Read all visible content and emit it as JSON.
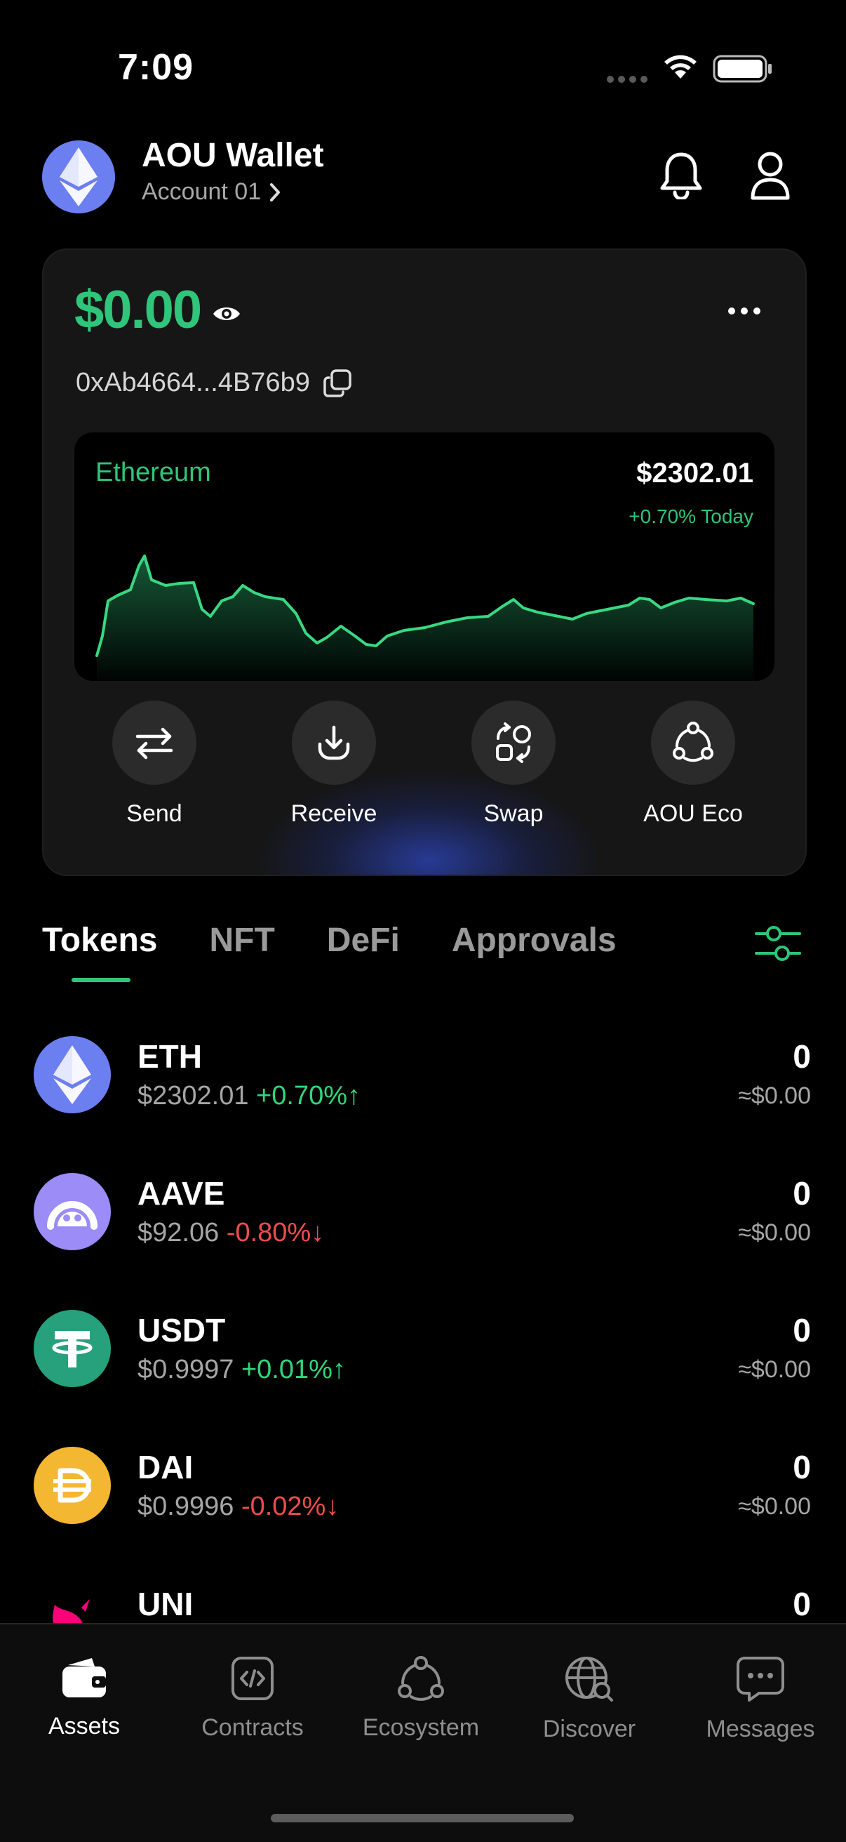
{
  "status_bar": {
    "time": "7:09"
  },
  "header": {
    "wallet_name": "AOU Wallet",
    "account": "Account 01"
  },
  "card": {
    "balance": "$0.00",
    "address": "0xAb4664...4B76b9",
    "chart": {
      "asset": "Ethereum",
      "price": "$2302.01",
      "change": "+0.70% Today"
    },
    "actions": [
      {
        "label": "Send",
        "icon": "send-icon"
      },
      {
        "label": "Receive",
        "icon": "receive-icon"
      },
      {
        "label": "Swap",
        "icon": "swap-icon"
      },
      {
        "label": "AOU Eco",
        "icon": "eco-icon"
      }
    ]
  },
  "tabs": [
    "Tokens",
    "NFT",
    "DeFi",
    "Approvals"
  ],
  "tokens": [
    {
      "symbol": "ETH",
      "price": "$2302.01",
      "change": "+0.70%",
      "arrow": "↑",
      "balance": "0",
      "value": "≈$0.00"
    },
    {
      "symbol": "AAVE",
      "price": "$92.06",
      "change": "-0.80%",
      "arrow": "↓",
      "balance": "0",
      "value": "≈$0.00"
    },
    {
      "symbol": "USDT",
      "price": "$0.9997",
      "change": "+0.01%",
      "arrow": "↑",
      "balance": "0",
      "value": "≈$0.00"
    },
    {
      "symbol": "DAI",
      "price": "$0.9996",
      "change": "-0.02%",
      "arrow": "↓",
      "balance": "0",
      "value": "≈$0.00"
    },
    {
      "symbol": "UNI",
      "price": "",
      "change": "",
      "arrow": "",
      "balance": "0",
      "value": ""
    }
  ],
  "nav": [
    "Assets",
    "Contracts",
    "Ecosystem",
    "Discover",
    "Messages"
  ],
  "colors": {
    "accent_green": "#2fc57a",
    "negative_red": "#ef4d4d",
    "background": "#000000",
    "card": "#161616"
  }
}
